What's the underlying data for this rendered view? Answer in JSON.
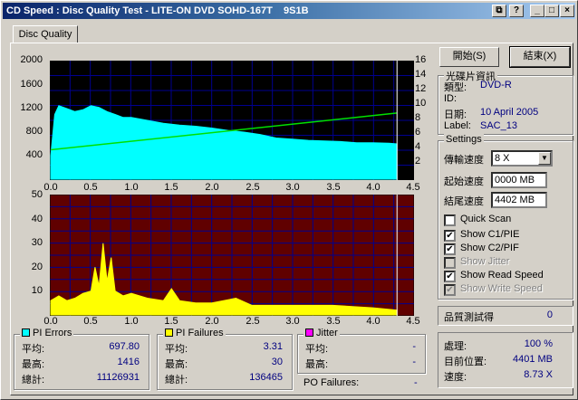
{
  "window": {
    "title": "CD Speed : Disc Quality Test - LITE-ON DVD SOHD-167T    9S1B",
    "buttons": [
      "⧉",
      "_",
      "□",
      "×"
    ]
  },
  "tab": {
    "label": "Disc Quality"
  },
  "chart_data": [
    {
      "type": "area",
      "title": "",
      "x_ticks": [
        "0.0",
        "0.5",
        "1.0",
        "1.5",
        "2.0",
        "2.5",
        "3.0",
        "3.5",
        "4.0",
        "4.5"
      ],
      "y_left_ticks": [
        "2000",
        "1600",
        "1200",
        "800",
        "400"
      ],
      "y_right_ticks": [
        "16",
        "14",
        "12",
        "10",
        "8",
        "6",
        "4",
        "2"
      ],
      "xlim": [
        0,
        4.5
      ],
      "ylim_left": [
        0,
        2000
      ],
      "ylim_right": [
        0,
        16
      ],
      "grid": true,
      "series": [
        {
          "name": "PI Errors",
          "color": "#00ffff",
          "x": [
            0.0,
            0.05,
            0.1,
            0.2,
            0.3,
            0.4,
            0.5,
            0.6,
            0.7,
            0.8,
            0.9,
            1.0,
            1.2,
            1.4,
            1.6,
            1.8,
            2.0,
            2.2,
            2.4,
            2.6,
            2.8,
            3.0,
            3.2,
            3.4,
            3.6,
            3.8,
            4.0,
            4.2,
            4.3
          ],
          "values": [
            400,
            1100,
            1250,
            1200,
            1150,
            1180,
            1250,
            1220,
            1150,
            1100,
            1050,
            1050,
            1000,
            950,
            920,
            900,
            870,
            830,
            800,
            760,
            700,
            680,
            660,
            650,
            640,
            620,
            620,
            610,
            600
          ]
        },
        {
          "name": "Read Speed",
          "color": "#00e000",
          "x": [
            0.0,
            4.3
          ],
          "values_right_axis": [
            4.0,
            9.0
          ]
        }
      ]
    },
    {
      "type": "area",
      "title": "",
      "x_ticks": [
        "0.0",
        "0.5",
        "1.0",
        "1.5",
        "2.0",
        "2.5",
        "3.0",
        "3.5",
        "4.0",
        "4.5"
      ],
      "y_left_ticks": [
        "50",
        "40",
        "30",
        "20",
        "10"
      ],
      "xlim": [
        0,
        4.5
      ],
      "ylim": [
        0,
        50
      ],
      "grid": true,
      "series": [
        {
          "name": "PI Failures",
          "color": "#ffff00",
          "x": [
            0.0,
            0.1,
            0.2,
            0.3,
            0.4,
            0.5,
            0.55,
            0.6,
            0.65,
            0.7,
            0.75,
            0.8,
            0.9,
            1.0,
            1.2,
            1.4,
            1.5,
            1.6,
            1.8,
            2.0,
            2.3,
            2.5,
            3.0,
            3.5,
            4.0,
            4.3
          ],
          "values": [
            6,
            8,
            6,
            7,
            9,
            10,
            20,
            12,
            30,
            14,
            24,
            10,
            8,
            9,
            7,
            6,
            11,
            6,
            5,
            5,
            7,
            4,
            4,
            4,
            3,
            2
          ]
        }
      ]
    }
  ],
  "buttons": {
    "start": "開始(S)",
    "end": "結束(X)"
  },
  "disc_info": {
    "title": "光碟片資訊",
    "type_label": "類型:",
    "type_value": "DVD-R",
    "id_label": "ID:",
    "id_value": "",
    "date_label": "日期:",
    "date_value": "10 April 2005",
    "label_label": "Label:",
    "label_value": "SAC_13"
  },
  "settings": {
    "title": "Settings",
    "speed_label": "傳輸速度",
    "speed_value": "8 X",
    "start_label": "起始速度",
    "start_value": "0000 MB",
    "end_label": "結尾速度",
    "end_value": "4402 MB",
    "options": [
      {
        "label": "Quick Scan",
        "checked": false,
        "disabled": false
      },
      {
        "label": "Show C1/PIE",
        "checked": true,
        "disabled": false
      },
      {
        "label": "Show C2/PIF",
        "checked": true,
        "disabled": false
      },
      {
        "label": "Show Jitter",
        "checked": false,
        "disabled": true
      },
      {
        "label": "Show Read Speed",
        "checked": true,
        "disabled": false
      },
      {
        "label": "Show Write Speed",
        "checked": true,
        "disabled": true
      }
    ]
  },
  "quality": {
    "label": "品質測試得",
    "value": "0"
  },
  "progress": {
    "process_label": "處理:",
    "process_value": "100 %",
    "pos_label": "目前位置:",
    "pos_value": "4401 MB",
    "speed_label": "速度:",
    "speed_value": "8.73 X"
  },
  "pi_errors": {
    "title": "PI Errors",
    "color": "#00ffff",
    "avg_label": "平均:",
    "avg": "697.80",
    "max_label": "最高:",
    "max": "1416",
    "total_label": "總計:",
    "total": "11126931"
  },
  "pi_failures": {
    "title": "PI Failures",
    "color": "#ffff00",
    "avg_label": "平均:",
    "avg": "3.31",
    "max_label": "最高:",
    "max": "30",
    "total_label": "總計:",
    "total": "136465"
  },
  "jitter": {
    "title": "Jitter",
    "color": "#ff00ff",
    "avg_label": "平均:",
    "avg": "-",
    "max_label": "最高:",
    "max": "-"
  },
  "po_failures": {
    "label": "PO Failures:",
    "value": "-"
  }
}
